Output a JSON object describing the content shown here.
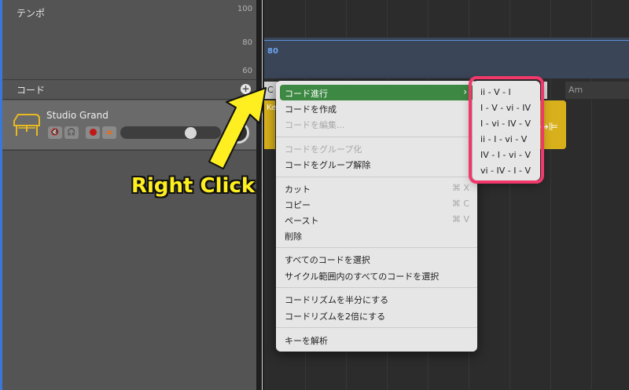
{
  "left_pane": {
    "tempo_label": "テンポ",
    "tempo_ticks": [
      "100",
      "80",
      "60"
    ],
    "chord_label": "コード",
    "add_chord_glyph": "+",
    "track": {
      "name": "Studio Grand",
      "icon": "grand-piano-icon",
      "buttons": [
        "mute-icon",
        "headphones-icon",
        "record-icon",
        "input-monitor-icon"
      ]
    }
  },
  "timeline": {
    "tempo_value": "80",
    "chord_cells": [
      "C",
      "Am"
    ],
    "region_name": "Ke"
  },
  "context_menu": {
    "items": [
      {
        "label": "コード進行",
        "highlighted": true,
        "submenu": true
      },
      {
        "label": "コードを作成"
      },
      {
        "label": "コードを編集...",
        "disabled": true
      },
      {
        "label": "コードをグループ化",
        "disabled": true
      },
      {
        "label": "コードをグループ解除"
      },
      {
        "label": "カット",
        "shortcut": "⌘ X"
      },
      {
        "label": "コピー",
        "shortcut": "⌘ C"
      },
      {
        "label": "ペースト",
        "shortcut": "⌘ V"
      },
      {
        "label": "削除"
      },
      {
        "label": "すべてのコードを選択"
      },
      {
        "label": "サイクル範囲内のすべてのコードを選択"
      },
      {
        "label": "コードリズムを半分にする"
      },
      {
        "label": "コードリズムを2倍にする"
      },
      {
        "label": "キーを解析"
      }
    ],
    "submenu_arrow": "›"
  },
  "submenu": {
    "items": [
      "ii - V - I",
      "I - V - vi - IV",
      "I - vi - IV - V",
      "ii - I - vi - V",
      "IV - I - vi - V",
      "vi - IV - I - V"
    ]
  },
  "annotation": {
    "text": "Right Click",
    "color": "#ffef21",
    "highlight_color": "#f0386b"
  },
  "colors": {
    "menu_highlight": "#3d8843",
    "region": "#d7b01c",
    "tempo_line": "#5b8ed8"
  }
}
